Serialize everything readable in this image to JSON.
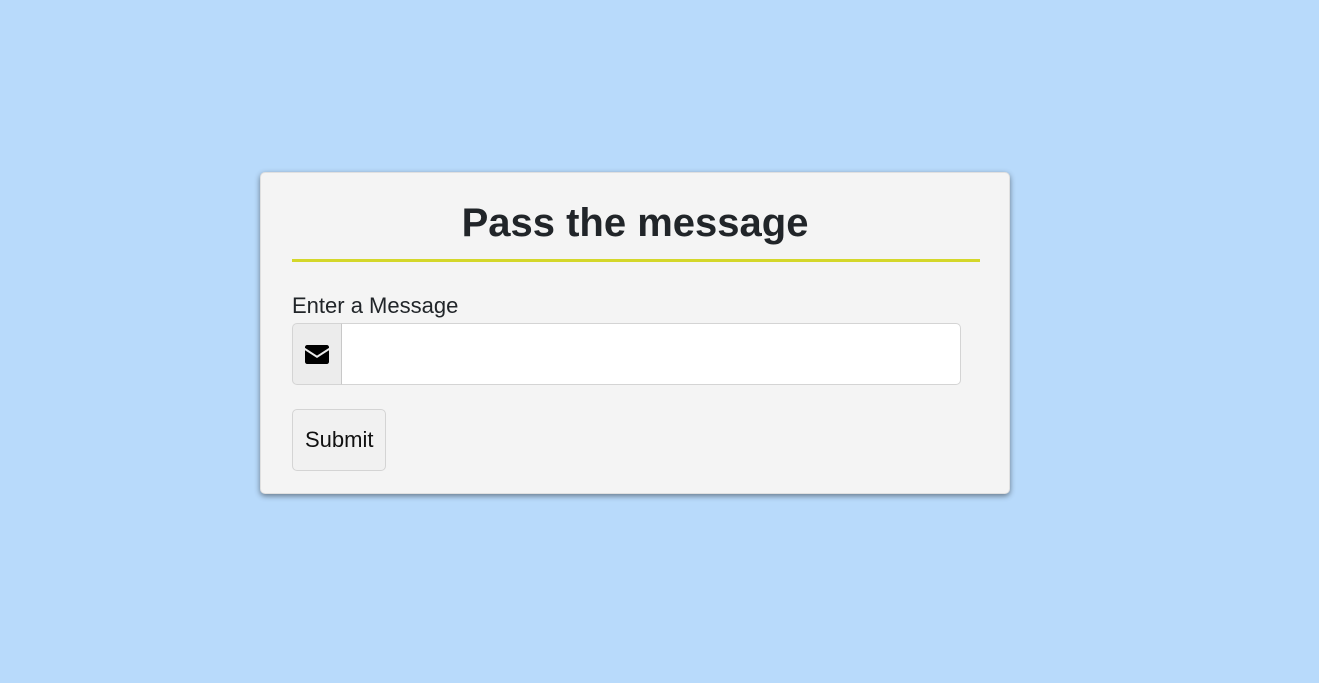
{
  "form": {
    "title": "Pass the message",
    "message_label": "Enter a Message",
    "message_value": "",
    "message_placeholder": "",
    "submit_label": "Submit",
    "icon": "envelope-icon"
  },
  "colors": {
    "background": "#b8dafb",
    "card": "#f4f4f4",
    "divider": "#d4d72a",
    "text": "#212529"
  }
}
